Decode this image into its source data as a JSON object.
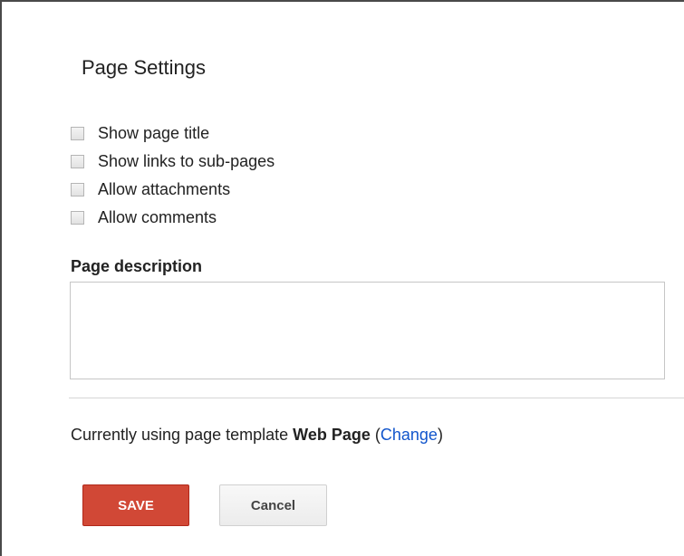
{
  "dialog": {
    "title": "Page Settings",
    "options": [
      {
        "label": "Show page title",
        "checked": false
      },
      {
        "label": "Show links to sub-pages",
        "checked": false
      },
      {
        "label": "Allow attachments",
        "checked": false
      },
      {
        "label": "Allow comments",
        "checked": false
      }
    ],
    "description": {
      "label": "Page description",
      "value": ""
    },
    "template": {
      "prefix": "Currently using page template",
      "name": "Web Page",
      "open_paren": "(",
      "change_link": "Change",
      "close_paren": ")"
    },
    "buttons": {
      "save_label": "SAVE",
      "cancel_label": "Cancel"
    },
    "colors": {
      "save_button": "#d14836",
      "link": "#1155cc"
    }
  }
}
